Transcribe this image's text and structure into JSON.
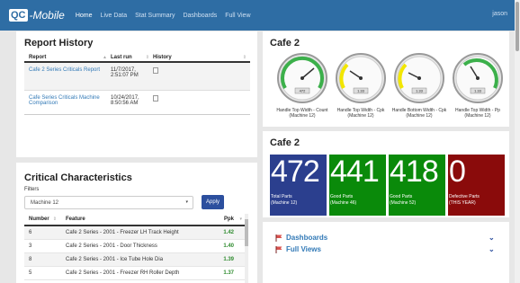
{
  "nav": {
    "logo_mark": "QC",
    "logo_text": "-Mobile",
    "links": [
      "Home",
      "Live Data",
      "Stat Summary",
      "Dashboards",
      "Full View"
    ],
    "user": "jason"
  },
  "report_history": {
    "title": "Report History",
    "columns": [
      "Report",
      "Last run",
      "History"
    ],
    "rows": [
      {
        "report": "Cafe 2 Series Criticals Report",
        "last_run": "11/7/2017, 2:51:07 PM"
      },
      {
        "report": "Cafe Series Criticals Machine Comparison",
        "last_run": "10/24/2017, 8:50:56 AM"
      }
    ]
  },
  "critical": {
    "title": "Critical Characteristics",
    "filters_label": "Filters",
    "selected_machine": "Machine 12",
    "apply_label": "Apply",
    "columns": [
      "Number",
      "Feature",
      "Ppk"
    ],
    "rows": [
      {
        "number": "6",
        "feature": "Cafe 2 Series - 2001 - Freezer LH Track Height",
        "ppk": "1.42"
      },
      {
        "number": "3",
        "feature": "Cafe 2 Series - 2001 - Door Thickness",
        "ppk": "1.40"
      },
      {
        "number": "8",
        "feature": "Cafe 2 Series - 2001 - Ice Tube Hole Dia",
        "ppk": "1.39"
      },
      {
        "number": "5",
        "feature": "Cafe 2 Series - 2001 - Freezer RH Roller Depth",
        "ppk": "1.37"
      }
    ]
  },
  "gauges_panel": {
    "title": "Cafe 2",
    "gauges": [
      {
        "label": "Handle Top Width - Count (Machine 12)",
        "zone_color": "#3cb04b",
        "readout": "472"
      },
      {
        "label": "Handle Top Width - Cpk (Machine 12)",
        "zone_color": "#f2e600",
        "readout": "1.33"
      },
      {
        "label": "Handle Bottom Width - Cpk (Machine 12)",
        "zone_color": "#f2e600",
        "readout": "1.33"
      },
      {
        "label": "Handle Top Width - Pp (Machine 12)",
        "zone_color": "#3cb04b",
        "readout": "1.33"
      }
    ]
  },
  "kpi_panel": {
    "title": "Cafe 2",
    "tiles": [
      {
        "value": "472",
        "label_line1": "Total Parts",
        "label_line2": "(Machine 12)",
        "color": "#2b3f8e"
      },
      {
        "value": "441",
        "label_line1": "Good Parts",
        "label_line2": "(Machine 46)",
        "color": "#0a8a0a"
      },
      {
        "value": "418",
        "label_line1": "Good Parts",
        "label_line2": "(Machine 52)",
        "color": "#0a8a0a"
      },
      {
        "value": "0",
        "label_line1": "Defective Parts",
        "label_line2": "(THIS YEAR)",
        "color": "#8a0b0b"
      }
    ]
  },
  "quick_links": [
    {
      "label": "Dashboards",
      "flag_icon": "flag-icon",
      "chevron_icon": "chevron-down-icon"
    },
    {
      "label": "Full Views",
      "flag_icon": "flag-icon",
      "chevron_icon": "chevron-down-icon"
    }
  ]
}
